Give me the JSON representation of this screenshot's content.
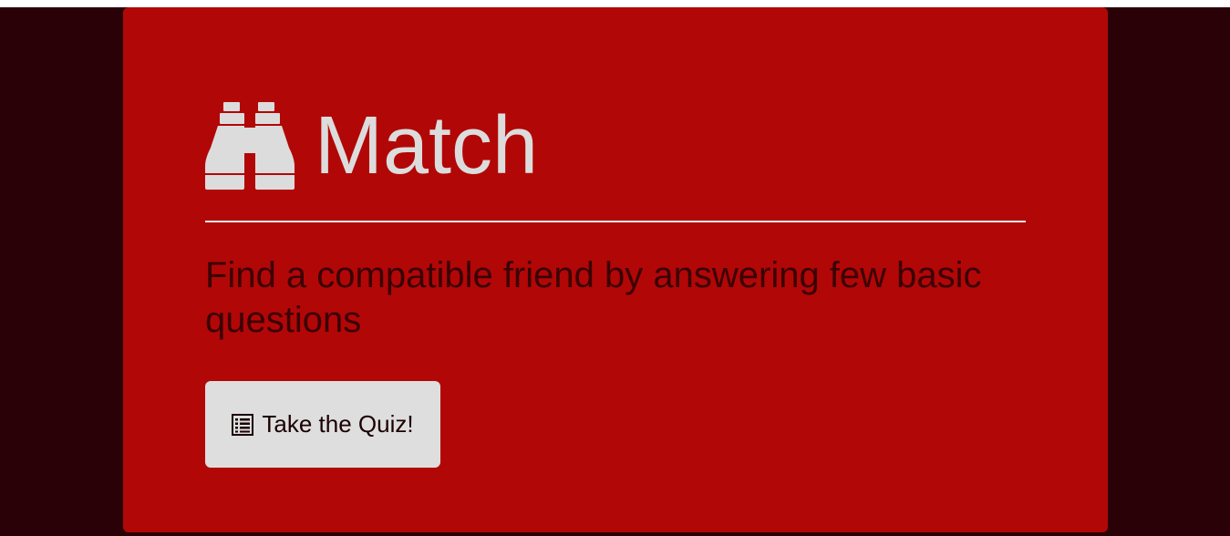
{
  "header": {
    "title": "Match",
    "icon": "binoculars-icon"
  },
  "lead": {
    "text": "Find a compatible friend by answering few basic questions"
  },
  "cta": {
    "label": "Take the Quiz!",
    "icon": "list-alt-icon"
  },
  "colors": {
    "page_background": "#2a0107",
    "panel_background": "#b20707",
    "title_text": "#dcdcdc",
    "lead_text": "#3a0205",
    "button_background": "#dedede"
  }
}
